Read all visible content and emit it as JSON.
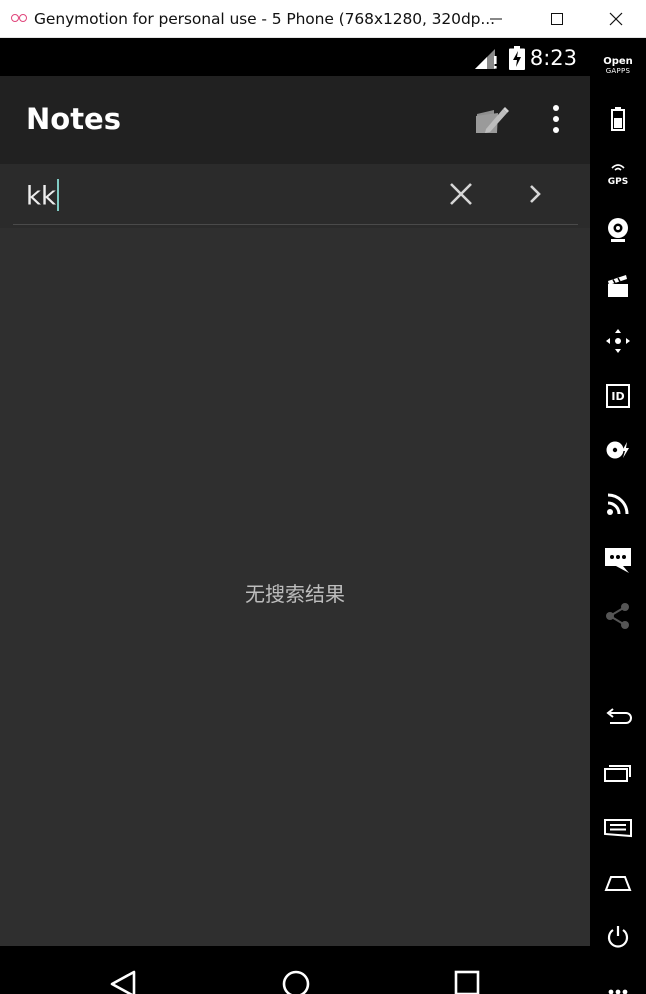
{
  "window": {
    "title": "Genymotion for personal use - 5 Phone (768x1280, 320dp..."
  },
  "statusbar": {
    "time": "8:23"
  },
  "appbar": {
    "title": "Notes"
  },
  "search": {
    "value": "kk"
  },
  "main": {
    "empty_message": "无搜索结果"
  },
  "sidebar": {
    "gapps_line1": "Open",
    "gapps_line2": "GAPPS",
    "gps_label": "GPS",
    "id_label": "ID"
  },
  "colors": {
    "screen_bg": "#2f2f2f",
    "appbar_bg": "#212121",
    "caret": "#80cbc4",
    "genymotion_logo": "#e0457b"
  }
}
